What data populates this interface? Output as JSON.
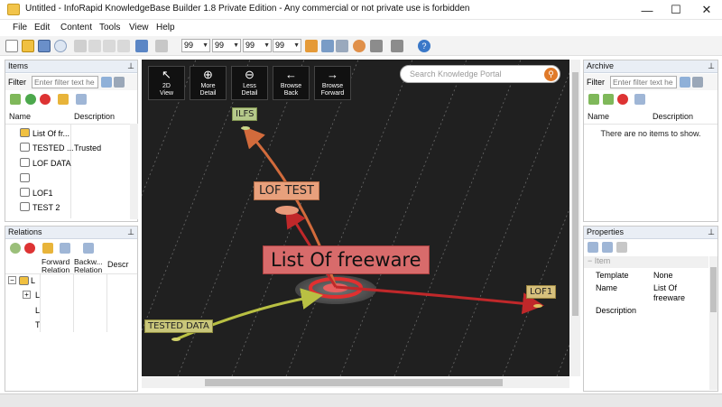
{
  "window": {
    "title": "Untitled - InfoRapid KnowledgeBase Builder 1.8 Private Edition - Any commercial or not private use is forbidden",
    "minimize": "—",
    "maximize": "☐",
    "close": "✕"
  },
  "menu": [
    "File",
    "Edit",
    "Content",
    "Tools",
    "View",
    "Help"
  ],
  "toolbar": {
    "levels": [
      "99",
      "99",
      "99",
      "99"
    ]
  },
  "items_panel": {
    "title": "Items",
    "pin": "📌",
    "filter_label": "Filter",
    "filter_placeholder": "Enter filter text he",
    "columns": [
      "Name",
      "Description"
    ],
    "rows": [
      {
        "name": "List Of fr...",
        "description": ""
      },
      {
        "name": "TESTED ...",
        "description": "Trusted"
      },
      {
        "name": "LOF DATA",
        "description": ""
      },
      {
        "name": "",
        "description": ""
      },
      {
        "name": "LOF1",
        "description": ""
      },
      {
        "name": "TEST 2",
        "description": ""
      }
    ]
  },
  "relations_panel": {
    "title": "Relations",
    "pin": "📌",
    "columns": [
      "Forward Relation",
      "Backw... Relation",
      "Descr"
    ],
    "tree": [
      "L",
      "L",
      "L",
      "T"
    ]
  },
  "graph": {
    "nav_buttons": [
      {
        "label1": "2D",
        "label2": "View",
        "icon": "2d-view-icon",
        "glyph": "↖"
      },
      {
        "label1": "More",
        "label2": "Detail",
        "icon": "zoom-in-icon",
        "glyph": "⊕"
      },
      {
        "label1": "Less",
        "label2": "Detail",
        "icon": "zoom-out-icon",
        "glyph": "⊖"
      },
      {
        "label1": "Browse",
        "label2": "Back",
        "icon": "arrow-left-icon",
        "glyph": "←"
      },
      {
        "label1": "Browse",
        "label2": "Forward",
        "icon": "arrow-right-icon",
        "glyph": "→"
      }
    ],
    "search_placeholder": "Search Knowledge Portal",
    "nodes": {
      "ilfs": "ILFS",
      "lof_test": "LOF TEST",
      "center": "List Of freeware",
      "lof1": "LOF1",
      "tested": "TESTED DATA"
    },
    "colors": {
      "canvas": "#202020",
      "center_box": "#d86b6b",
      "lof_test_box": "#e8a07c",
      "ilfs_box": "#b5c98a",
      "lof1_box": "#d6c07c",
      "tested_box": "#c9c67a",
      "edge_red": "#c0282a",
      "edge_orange": "#d26b3c",
      "edge_yellow": "#b9c043"
    }
  },
  "archive_panel": {
    "title": "Archive",
    "pin": "📌",
    "filter_label": "Filter",
    "filter_placeholder": "Enter filter text he",
    "columns": [
      "Name",
      "Description"
    ],
    "empty_text": "There are no items to show."
  },
  "properties_panel": {
    "title": "Properties",
    "pin": "📌",
    "group": "Item",
    "props": [
      {
        "key": "Template",
        "value": "None"
      },
      {
        "key": "Name",
        "value": "List Of freeware"
      },
      {
        "key": "Description",
        "value": ""
      }
    ]
  }
}
